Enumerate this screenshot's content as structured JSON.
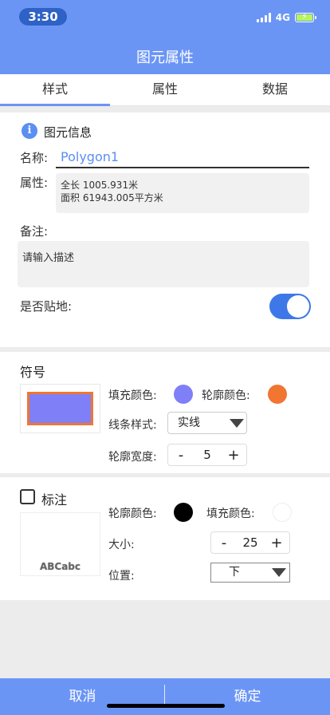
{
  "status": {
    "time": "3:30",
    "network": "4G"
  },
  "header": {
    "title": "图元属性"
  },
  "tabs": [
    {
      "label": "样式",
      "active": true
    },
    {
      "label": "属性",
      "active": false
    },
    {
      "label": "数据",
      "active": false
    }
  ],
  "info": {
    "section_title": "图元信息",
    "name_label": "名称:",
    "name_value": "Polygon1",
    "attr_label": "属性:",
    "attr_line1": "全长 1005.931米",
    "attr_line2": "面积 61943.005平方米",
    "note_label": "备注:",
    "note_placeholder": "请输入描述",
    "ground_label": "是否贴地:",
    "ground_on": true
  },
  "symbol": {
    "section_title": "符号",
    "fill_color_label": "填充颜色:",
    "fill_color": "#7f80f7",
    "outline_color_label": "轮廓颜色:",
    "outline_color": "#f07632",
    "line_style_label": "线条样式:",
    "line_style_value": "实线",
    "outline_width_label": "轮廓宽度:",
    "outline_width_value": "5",
    "minus": "-",
    "plus": "+"
  },
  "annotation": {
    "section_title": "标注",
    "checked": false,
    "outline_color_label": "轮廓颜色:",
    "outline_color": "#000000",
    "fill_color_label": "填充颜色:",
    "fill_color": "#ffffff",
    "size_label": "大小:",
    "size_value": "25",
    "position_label": "位置:",
    "position_value": "下",
    "preview_text": "ABCabc",
    "minus": "-",
    "plus": "+"
  },
  "footer": {
    "cancel_label": "取消",
    "confirm_label": "确定"
  }
}
